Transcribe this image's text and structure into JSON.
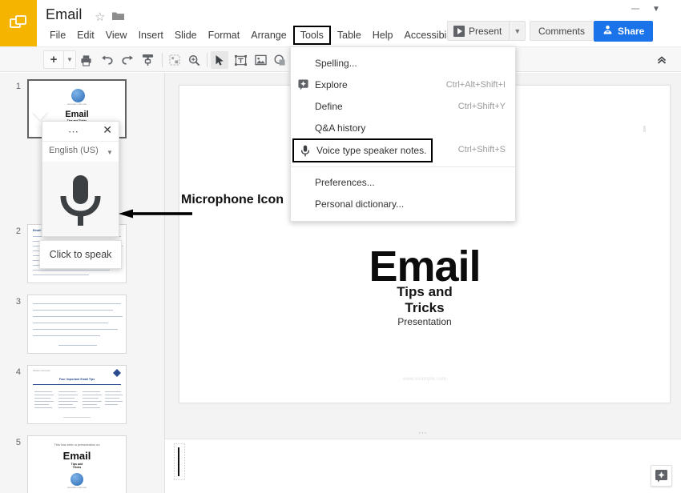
{
  "header": {
    "logo_icon": "slides-logo-icon",
    "doc_title": "Email",
    "star_icon": "star-outline-icon",
    "folder_icon": "folder-icon",
    "menus": [
      "File",
      "Edit",
      "View",
      "Insert",
      "Slide",
      "Format",
      "Arrange",
      "Tools",
      "Table",
      "Help",
      "Accessibility"
    ],
    "highlighted_menu": "Tools",
    "present_label": "Present",
    "present_caret_icon": "chevron-down-icon",
    "present_play_icon": "play-icon",
    "comments_label": "Comments",
    "share_label": "Share",
    "share_icon": "person-lock-icon",
    "share_color": "#1a73e8",
    "account_caret_icon": "chevron-down-icon"
  },
  "toolbar": {
    "new_slide_icon": "plus-icon",
    "new_slide_caret_icon": "chevron-down-icon",
    "items": [
      {
        "name": "print-icon"
      },
      {
        "name": "undo-icon"
      },
      {
        "name": "redo-icon"
      },
      {
        "name": "paint-format-icon"
      },
      {
        "name": "zoom-fit-icon"
      },
      {
        "name": "zoom-icon"
      },
      {
        "name": "select-cursor-icon"
      },
      {
        "name": "text-box-icon"
      },
      {
        "name": "insert-image-icon"
      },
      {
        "name": "shape-icon"
      },
      {
        "name": "shape-caret-icon"
      }
    ],
    "collapse_icon": "double-chevron-up-icon"
  },
  "tools_menu": {
    "items": [
      {
        "label": "Spelling...",
        "accel": "",
        "icon": ""
      },
      {
        "label": "Explore",
        "accel": "Ctrl+Alt+Shift+I",
        "icon": "explore-icon"
      },
      {
        "label": "Define",
        "accel": "Ctrl+Shift+Y",
        "icon": ""
      },
      {
        "label": "Q&A history",
        "accel": "",
        "icon": ""
      },
      {
        "label": "Voice type speaker notes.",
        "accel": "Ctrl+Shift+S",
        "icon": "microphone-icon",
        "highlighted": true
      }
    ],
    "items_after_separator": [
      {
        "label": "Preferences...",
        "accel": "",
        "icon": ""
      },
      {
        "label": "Personal dictionary...",
        "accel": "",
        "icon": ""
      }
    ]
  },
  "voice_popup": {
    "dots_icon": "more-options-icon",
    "close_icon": "close-icon",
    "language": "English (US)",
    "language_caret_icon": "chevron-down-icon",
    "mic_icon": "microphone-icon",
    "tooltip": "Click to speak"
  },
  "annotation": {
    "arrow_icon": "left-arrow-icon",
    "label": "Microphone Icon"
  },
  "filmstrip": {
    "slides": [
      {
        "number": "1",
        "current": true,
        "title": "Email",
        "subtitle": "Tips and Tricks",
        "kind": "title-logo"
      },
      {
        "number": "2",
        "current": false,
        "title": "Email Privacy",
        "subtitle": "",
        "kind": "text-lines"
      },
      {
        "number": "3",
        "current": false,
        "title": "",
        "subtitle": "",
        "kind": "text-lines"
      },
      {
        "number": "4",
        "current": false,
        "title": "Four Important Email Tips",
        "subtitle": "",
        "kind": "four-columns"
      },
      {
        "number": "5",
        "current": false,
        "title": "Email",
        "subtitle": "This has been a presentation on",
        "kind": "closing"
      }
    ]
  },
  "slide": {
    "title": "Email",
    "subtitle_line1": "Tips and",
    "subtitle_line2": "Tricks",
    "subtitle2": "Presentation",
    "footer": "www.example.com"
  },
  "notes": {
    "grip_icon": "drag-handle-icon",
    "placeholder": "",
    "explore_icon": "explore-icon"
  }
}
